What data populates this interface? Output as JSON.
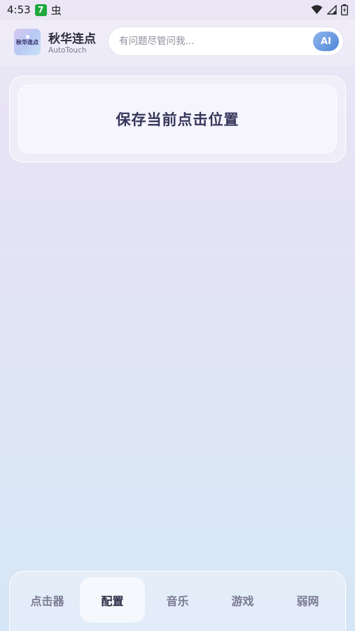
{
  "status_bar": {
    "time": "4:53",
    "notification_badge": "7",
    "bug_glyph": "虫"
  },
  "header": {
    "logo_text": "秋华连点",
    "app_title": "秋华连点",
    "app_subtitle": "AutoTouch",
    "search_placeholder": "有问题尽管问我...",
    "ai_button_label": "AI"
  },
  "main": {
    "card_label": "保存当前点击位置"
  },
  "bottom_nav": {
    "items": [
      {
        "label": "点击器"
      },
      {
        "label": "配置"
      },
      {
        "label": "音乐"
      },
      {
        "label": "游戏"
      },
      {
        "label": "弱网"
      }
    ],
    "active_index": 1
  },
  "colors": {
    "accent": "#5b8fdc",
    "text_dark": "#2b2b3f",
    "nav_inactive": "#7a7a92"
  },
  "icons": [
    "wifi-icon",
    "signal-icon",
    "battery-icon",
    "bug-icon"
  ]
}
